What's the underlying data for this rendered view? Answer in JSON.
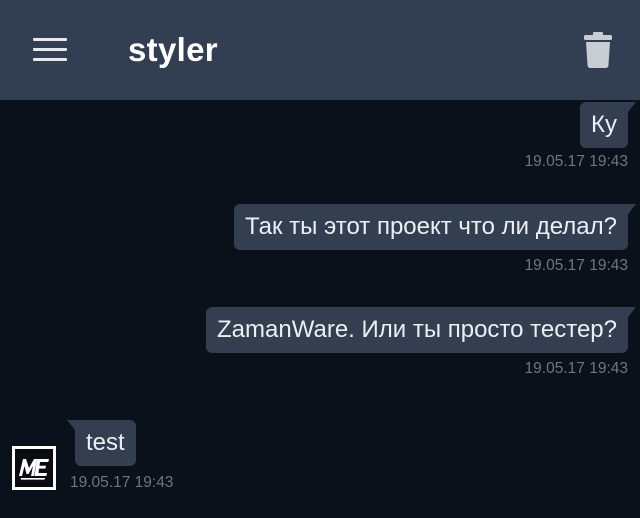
{
  "appbar": {
    "title": "styler",
    "menu_icon": "menu-icon",
    "delete_icon": "trash-icon",
    "background": "#323e51"
  },
  "messages": [
    {
      "direction": "outgoing",
      "text": "Ку",
      "time": "19.05.17 19:43"
    },
    {
      "direction": "outgoing",
      "text": "Так ты этот проект что ли делал?",
      "time": "19.05.17 19:43"
    },
    {
      "direction": "outgoing",
      "text": "ZamanWare. Или ты просто тестер?",
      "time": "19.05.17 19:43"
    },
    {
      "direction": "incoming",
      "text": "test",
      "time": "19.05.17 19:43",
      "avatar": "avatar-logo-icon"
    }
  ],
  "colors": {
    "chat_background": "#0a111a",
    "bubble": "#333e51",
    "bubble_text": "#eceef2",
    "timestamp": "#6e7682"
  }
}
